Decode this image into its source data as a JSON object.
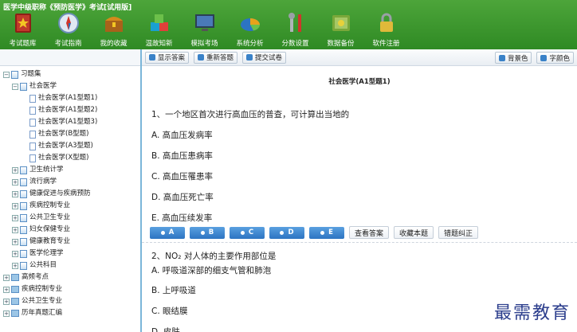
{
  "app": {
    "title": "医学中级职称《预防医学》考试[试用版]"
  },
  "toolbar": {
    "items": [
      {
        "label": "考试题库",
        "icon": "book-star-icon",
        "color": "#c0392b"
      },
      {
        "label": "考试指南",
        "icon": "compass-icon",
        "color": "#2d6db5"
      },
      {
        "label": "我的收藏",
        "icon": "treasure-chest-icon",
        "color": "#d48a1c"
      },
      {
        "label": "温故知新",
        "icon": "cubes-icon",
        "color": "#1aa0d0"
      },
      {
        "label": "模拟考场",
        "icon": "monitor-icon",
        "color": "#2b3f55"
      },
      {
        "label": "系统分析",
        "icon": "pie-chart-icon",
        "color": "#e8a21a"
      },
      {
        "label": "分数设置",
        "icon": "tools-icon",
        "color": "#b0b4b8"
      },
      {
        "label": "数据备份",
        "icon": "safe-icon",
        "color": "#7aa83a"
      },
      {
        "label": "软件注册",
        "icon": "lock-icon",
        "color": "#e0b93a"
      }
    ]
  },
  "tree": {
    "root": "习题集",
    "parent": "社会医学",
    "children": [
      "社会医学(A1型题1)",
      "社会医学(A1型题2)",
      "社会医学(A1型题3)",
      "社会医学(B型题)",
      "社会医学(A3型题)",
      "社会医学(X型题)"
    ],
    "groups": [
      "卫生统计学",
      "流行病学",
      "健康促进与疾病预防",
      "疾病控制专业",
      "公共卫生专业",
      "妇女保健专业",
      "健康教育专业",
      "医学伦理学",
      "公共科目"
    ],
    "roots": [
      "高频考点",
      "疾病控制专业",
      "公共卫生专业",
      "历年真题汇编"
    ]
  },
  "main_toolbar": {
    "show_answer": "显示答案",
    "restart": "重新答题",
    "submit": "提交试卷",
    "bg_color": "背景色",
    "font_color": "字颜色"
  },
  "content": {
    "section_title": "社会医学(A1型题1)",
    "q1": {
      "text": "1、一个地区首次进行高血压的普查，可计算出当地的",
      "options": [
        "A. 高血压发病率",
        "B. 高血压患病率",
        "C. 高血压罹患率",
        "D. 高血压死亡率",
        "E. 高血压续发率"
      ]
    },
    "answers": [
      "A",
      "B",
      "C",
      "D",
      "E"
    ],
    "actions": {
      "view_answer": "查看答案",
      "favorite": "收藏本题",
      "report_error": "错题纠正"
    },
    "q2": {
      "text": "2、NO₂ 对人体的主要作用部位是",
      "options": [
        "A. 呼吸道深部的细支气管和肺泡",
        "B. 上呼吸道",
        "C. 眼结膜",
        "D. 皮肤"
      ]
    }
  },
  "watermark": "最需教育"
}
